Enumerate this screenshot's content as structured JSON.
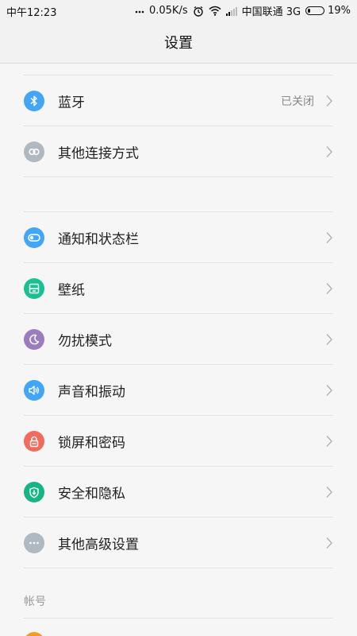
{
  "status_bar": {
    "time": "中午12:23",
    "speed": "0.05K/s",
    "carrier": "中国联通 3G",
    "battery_percent": "19%",
    "battery_level": 0.19,
    "icons": [
      "dots-icon",
      "alarm-icon",
      "wifi-icon",
      "signal-icon",
      "battery-icon"
    ]
  },
  "header": {
    "title": "设置"
  },
  "sections": [
    {
      "items": [
        {
          "label": "蓝牙",
          "value": "已关闭",
          "icon": "bluetooth-icon",
          "color": "#42a5f5"
        },
        {
          "label": "其他连接方式",
          "value": "",
          "icon": "link-icon",
          "color": "#b0b8c1"
        }
      ]
    },
    {
      "items": [
        {
          "label": "通知和状态栏",
          "value": "",
          "icon": "toggle-icon",
          "color": "#42a5f5"
        },
        {
          "label": "壁纸",
          "value": "",
          "icon": "wallpaper-icon",
          "color": "#17c191"
        },
        {
          "label": "勿扰模式",
          "value": "",
          "icon": "moon-icon",
          "color": "#9a7cbf"
        },
        {
          "label": "声音和振动",
          "value": "",
          "icon": "speaker-icon",
          "color": "#42a5f5"
        },
        {
          "label": "锁屏和密码",
          "value": "",
          "icon": "lock-icon",
          "color": "#f26a5b"
        },
        {
          "label": "安全和隐私",
          "value": "",
          "icon": "shield-icon",
          "color": "#17b586"
        },
        {
          "label": "其他高级设置",
          "value": "",
          "icon": "more-icon",
          "color": "#b0b8c1"
        }
      ]
    }
  ],
  "account_section": {
    "title": "帐号",
    "peek_color": "#f59a23"
  }
}
